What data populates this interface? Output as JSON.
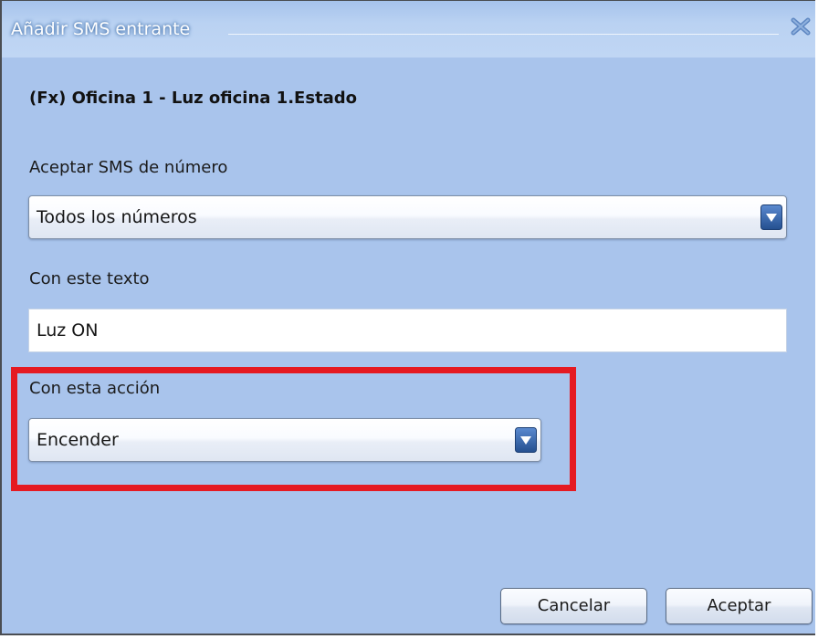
{
  "dialog": {
    "title": "Añadir SMS entrante",
    "close_icon": "close-icon",
    "heading": "(Fx) Oficina 1 - Luz oficina 1.Estado"
  },
  "fields": {
    "number_label": "Aceptar SMS de número",
    "number_select_value": "Todos los números",
    "text_label": "Con este texto",
    "text_value": "Luz ON",
    "action_label": "Con esta acción",
    "action_select_value": "Encender"
  },
  "buttons": {
    "cancel": "Cancelar",
    "accept": "Aceptar"
  },
  "colors": {
    "dialog_background": "#a9c4ec",
    "highlight_border": "#e51a22",
    "dropdown_arrow": "#2f5e9f"
  },
  "icons": {
    "dropdown": "chevron-down-icon"
  }
}
